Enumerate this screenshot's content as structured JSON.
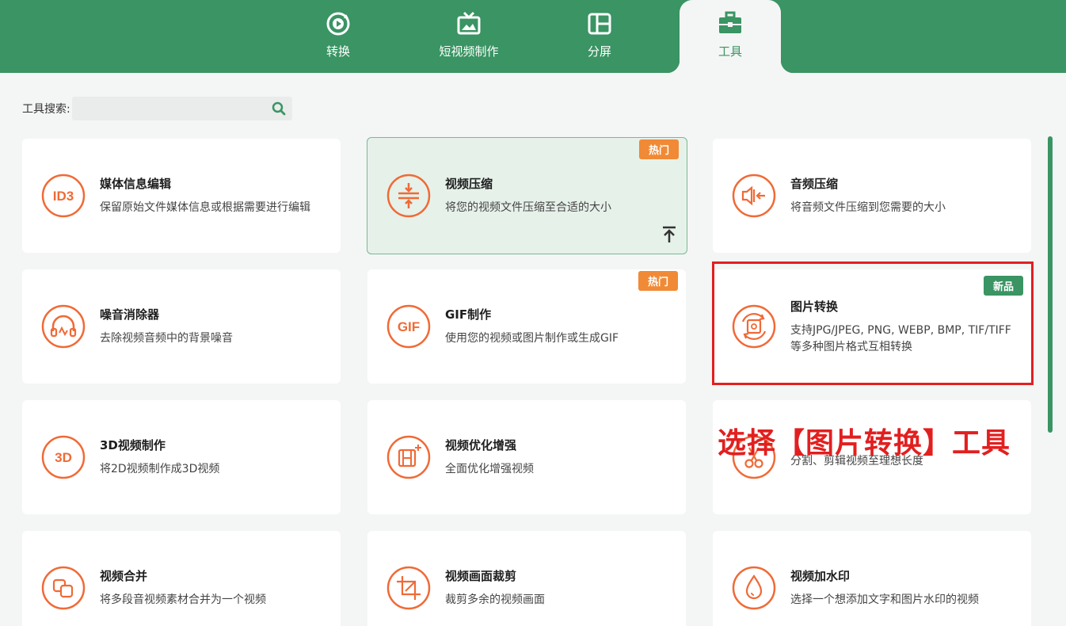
{
  "nav": {
    "tabs": [
      {
        "label": "转换",
        "icon": "convert-icon"
      },
      {
        "label": "短视频制作",
        "icon": "tv-icon"
      },
      {
        "label": "分屏",
        "icon": "split-screen-icon"
      },
      {
        "label": "工具",
        "icon": "toolbox-icon",
        "active": true
      }
    ]
  },
  "search": {
    "label": "工具搜索:",
    "value": "",
    "placeholder": ""
  },
  "cards": [
    {
      "title": "媒体信息编辑",
      "desc": "保留原始文件媒体信息或根据需要进行编辑",
      "icon_text": "ID3"
    },
    {
      "title": "视频压缩",
      "desc": "将您的视频文件压缩至合适的大小",
      "badge": "热门"
    },
    {
      "title": "音频压缩",
      "desc": "将音频文件压缩到您需要的大小"
    },
    {
      "title": "噪音消除器",
      "desc": "去除视频音频中的背景噪音"
    },
    {
      "title": "GIF制作",
      "desc": "使用您的视频或图片制作或生成GIF",
      "badge": "热门",
      "icon_text": "GIF"
    },
    {
      "title": "图片转换",
      "desc": "支持JPG/JPEG, PNG, WEBP, BMP, TIF/TIFF等多种图片格式互相转换",
      "badge": "新品"
    },
    {
      "title": "3D视频制作",
      "desc": "将2D视频制作成3D视频",
      "icon_text": "3D"
    },
    {
      "title": "视频优化增强",
      "desc": "全面优化增强视频"
    },
    {
      "title": "",
      "desc": "分割、剪辑视频至理想长度"
    },
    {
      "title": "视频合并",
      "desc": "将多段音视频素材合并为一个视频"
    },
    {
      "title": "视频画面裁剪",
      "desc": "裁剪多余的视频画面"
    },
    {
      "title": "视频加水印",
      "desc": "选择一个想添加文字和图片水印的视频"
    }
  ],
  "annotation": "选择【图片转换】工具",
  "colors": {
    "brand": "#3a9463",
    "accent": "#f06a36",
    "hot": "#f08a36",
    "annotation": "#e21f1f"
  }
}
